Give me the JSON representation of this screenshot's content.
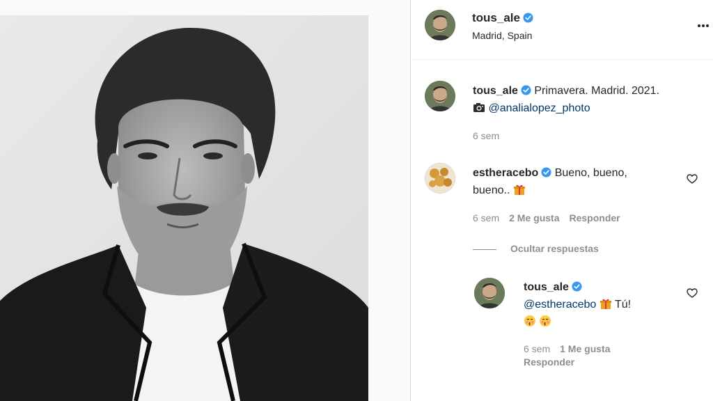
{
  "post": {
    "username": "tous_ale",
    "location": "Madrid, Spain"
  },
  "caption": {
    "username": "tous_ale",
    "text": "Primavera. Madrid. 2021.",
    "camera_icon": "camera-emoji",
    "mention": "@analialopez_photo",
    "time": "6 sem"
  },
  "comments": [
    {
      "username": "estheracebo",
      "text_line1": "Bueno, bueno,",
      "text_line2": "bueno..",
      "emoji": "gift-emoji",
      "time": "6 sem",
      "likes": "2 Me gusta",
      "reply": "Responder"
    }
  ],
  "replies_toggle": "Ocultar respuestas",
  "reply": {
    "username": "tous_ale",
    "mention": "@estheracebo",
    "emoji": "gift-emoji",
    "text": "Tú!",
    "emojis_line2": [
      "kissing-face-emoji",
      "kissing-face-emoji"
    ],
    "time": "6 sem",
    "likes": "1 Me gusta",
    "reply": "Responder"
  },
  "colors": {
    "verified": "#3897f0",
    "mention": "#00376b",
    "muted": "#8e8e8e"
  }
}
